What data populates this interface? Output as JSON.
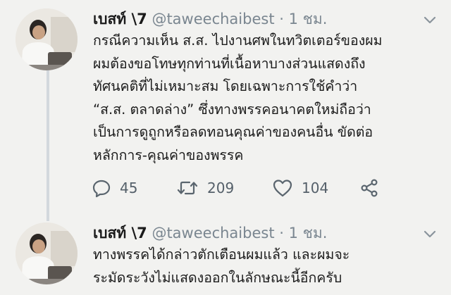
{
  "tweets": [
    {
      "display_name": "เบสท์ \\7",
      "handle": "@taweechaibest",
      "separator": "·",
      "time": "1 ชม.",
      "avatar_icon": "user-avatar",
      "text_lines": [
        "กรณีความเห็น ส.ส. ไปงานศพในทวิตเตอร์ของผม",
        "ผมต้องขอโทษทุกท่านที่เนื้อหาบางส่วนแสดงถึง",
        "ทัศนคติที่ไม่เหมาะสม โดยเฉพาะการใช้คำว่า",
        "“ส.ส. ตลาดล่าง” ซึ่งทางพรรคอนาคตใหม่ถือว่า",
        "เป็นการดูถูกหรือลดทอนคุณค่าของคนอื่น ขัดต่อ",
        "หลักการ-คุณค่าของพรรค"
      ],
      "actions": {
        "replies": "45",
        "retweets": "209",
        "likes": "104"
      }
    },
    {
      "display_name": "เบสท์ \\7",
      "handle": "@taweechaibest",
      "separator": "·",
      "time": "1 ชม.",
      "avatar_icon": "user-avatar",
      "text_lines": [
        "ทางพรรคได้กล่าวตักเตือนผมแล้ว และผมจะ",
        "ระมัดระวังไม่แสดงออกในลักษณะนี้อีกครับ"
      ]
    }
  ],
  "icons": {
    "reply": "reply-icon",
    "retweet": "retweet-icon",
    "like": "heart-icon",
    "share": "share-icon",
    "menu": "chevron-down-icon"
  },
  "colors": {
    "background": "#f2f2f0",
    "text": "#1b1b1b",
    "muted": "#7a8690",
    "thread_line": "#d3d8dd"
  }
}
